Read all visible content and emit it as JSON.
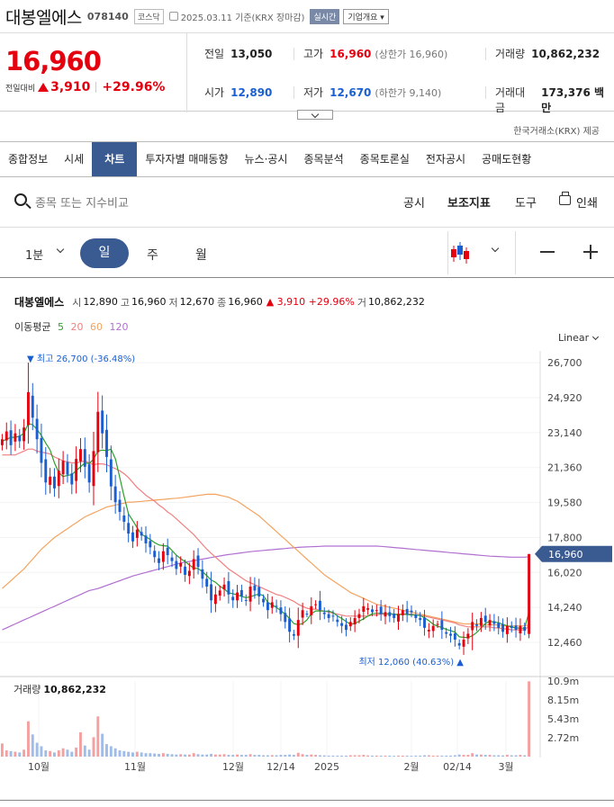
{
  "header": {
    "name": "대봉엘에스",
    "code": "078140",
    "market": "코스닥",
    "date": "2025.03.11 기준(KRX 장마감)",
    "live": "실시간",
    "corp": "기업개요 ▾"
  },
  "quote": {
    "price": "16,960",
    "change_label": "전일대비",
    "change": "3,910",
    "change_pct": "+29.96%",
    "prev_label": "전일",
    "prev": "13,050",
    "high_label": "고가",
    "high": "16,960",
    "upper_limit": "(상한가 16,960)",
    "volume_label": "거래량",
    "volume": "10,862,232",
    "open_label": "시가",
    "open": "12,890",
    "low_label": "저가",
    "low": "12,670",
    "lower_limit": "(하한가 9,140)",
    "amount_label": "거래대금",
    "amount": "173,376 백만",
    "provider": "한국거래소(KRX) 제공"
  },
  "tabs": [
    "종합정보",
    "시세",
    "차트",
    "투자자별 매매동향",
    "뉴스·공시",
    "종목분석",
    "종목토론실",
    "전자공시",
    "공매도현황"
  ],
  "active_tab": "차트",
  "toolbar": {
    "search_placeholder": "종목 또는 지수비교",
    "disclosure": "공시",
    "indicator": "보조지표",
    "tools": "도구",
    "print": "인쇄"
  },
  "period": {
    "minute": "1분",
    "day": "일",
    "week": "주",
    "month": "월"
  },
  "chart_info": {
    "name": "대봉엘에스",
    "open_label": "시",
    "open": "12,890",
    "high_label": "고",
    "high": "16,960",
    "low_label": "저",
    "low": "12,670",
    "close_label": "종",
    "close": "16,960",
    "change": "▲ 3,910 +29.96%",
    "vol_label": "거",
    "vol": "10,862,232",
    "ma_label": "이동평균",
    "ma": [
      "5",
      "20",
      "60",
      "120"
    ],
    "scale": "Linear"
  },
  "colors": {
    "up": "#e4000f",
    "down": "#1a5fd1",
    "accent": "#3a5a92",
    "ma5": "#2ca02c",
    "ma20": "#f08080",
    "ma60": "#f4a460",
    "ma120": "#b070d0"
  },
  "chart_data": {
    "type": "candlestick",
    "price_axis": [
      "26,700",
      "24,920",
      "23,140",
      "21,360",
      "19,580",
      "17,800",
      "16,020",
      "14,240",
      "12,460"
    ],
    "ylim": [
      11500,
      27300
    ],
    "current_price_label": "16,960",
    "current_price": 16960,
    "max_label": "최고 26,700 (-36.48%)",
    "max": 26700,
    "min_label": "최저 12,060 (40.63%)",
    "min": 12060,
    "x_labels": [
      "10월",
      "11월",
      "12월",
      "12/14",
      "2025",
      "2월",
      "02/14",
      "3월"
    ],
    "volume_label": "거래량",
    "volume_value": "10,862,232",
    "volume_axis": [
      "10.9m",
      "8.15m",
      "5.43m",
      "2.72m"
    ],
    "volume_ylim": [
      0,
      10900000
    ],
    "closes": [
      22800,
      23200,
      22500,
      23100,
      22700,
      23400,
      25200,
      23900,
      22800,
      21600,
      20600,
      20900,
      20300,
      21200,
      21700,
      21000,
      20500,
      21800,
      22300,
      21400,
      20600,
      22200,
      24200,
      23100,
      21900,
      20400,
      19600,
      19100,
      18600,
      18000,
      17600,
      18200,
      17900,
      17500,
      17300,
      16800,
      16500,
      17100,
      16900,
      16600,
      16200,
      16500,
      15900,
      16100,
      16700,
      16300,
      15700,
      15300,
      14600,
      14900,
      15100,
      15400,
      14900,
      14600,
      15000,
      14800,
      14600,
      15300,
      15100,
      14800,
      14500,
      14100,
      14500,
      14300,
      13900,
      13500,
      13000,
      12800,
      13600,
      14100,
      13900,
      14300,
      14400,
      14100,
      13900,
      13700,
      13800,
      13500,
      13300,
      13100,
      13500,
      13700,
      13900,
      14300,
      14200,
      14000,
      14100,
      13900,
      14000,
      13800,
      13700,
      13900,
      14100,
      13900,
      14000,
      13700,
      13600,
      13200,
      13100,
      13300,
      13400,
      13100,
      12900,
      12800,
      12600,
      12300,
      12600,
      12900,
      13500,
      13300,
      13700,
      13500,
      13600,
      13400,
      13200,
      13000,
      13300,
      13200,
      13100,
      13300,
      13050,
      16960
    ],
    "ma5": [
      22700,
      22800,
      22900,
      22900,
      22960,
      23100,
      23600,
      23540,
      23300,
      23000,
      22600,
      22260,
      21600,
      21100,
      20900,
      20960,
      21000,
      21200,
      21400,
      21600,
      21560,
      21800,
      22200,
      22250,
      22220,
      22300,
      21800,
      20850,
      19900,
      19000,
      18660,
      18300,
      17960,
      17840,
      17700,
      17540,
      17420,
      17380,
      17360,
      17140,
      16900,
      16720,
      16580,
      16400,
      16240,
      16220,
      16060,
      15860,
      15640,
      15520,
      15320,
      15180,
      14980,
      14940,
      14880,
      14800,
      14740,
      14780,
      14860,
      14920,
      14840,
      14500,
      14370,
      14240,
      14080,
      13900,
      13680,
      13420,
      13360,
      13420,
      13600,
      13920,
      14060,
      14060,
      14050,
      14050,
      13980,
      13800,
      13680,
      13520,
      13380,
      13420,
      13540,
      13660,
      13800,
      13920,
      13940,
      13940,
      13920,
      13920,
      13900,
      13860,
      13900,
      13880,
      13860,
      13860,
      13820,
      13720,
      13560,
      13380,
      13280,
      13220,
      13120,
      13060,
      12980,
      12740,
      12720,
      12700,
      12800,
      12960,
      13200,
      13420,
      13540,
      13500,
      13460,
      13380,
      13300,
      13240,
      13200,
      13180,
      13190,
      14000
    ],
    "ma20": [
      22000,
      22000,
      22000,
      22000,
      22100,
      22200,
      22300,
      22300,
      22200,
      22150,
      22100,
      22050,
      21900,
      21800,
      21700,
      21650,
      21600,
      21600,
      21650,
      21700,
      21600,
      21500,
      21550,
      21550,
      21500,
      21400,
      21300,
      21200,
      21050,
      20850,
      20600,
      20350,
      20150,
      19950,
      19800,
      19650,
      19450,
      19300,
      19100,
      18950,
      18750,
      18550,
      18350,
      18150,
      17950,
      17700,
      17450,
      17200,
      17000,
      16800,
      16600,
      16400,
      16200,
      16050,
      15900,
      15750,
      15600,
      15500,
      15400,
      15300,
      15200,
      15100,
      15000,
      14900,
      14850,
      14750,
      14650,
      14550,
      14400,
      14300,
      14200,
      14150,
      14150,
      14100,
      14050,
      14000,
      13950,
      13900,
      13850,
      13800,
      13800,
      13800,
      13800,
      13800,
      13800,
      13850,
      13850,
      13900,
      13900,
      13900,
      13900,
      13900,
      13900,
      13900,
      13900,
      13850,
      13850,
      13800,
      13750,
      13700,
      13650,
      13600,
      13550,
      13500,
      13450,
      13350,
      13300,
      13250,
      13250,
      13250,
      13250,
      13250,
      13250,
      13200,
      13200,
      13150,
      13150,
      13100,
      13100,
      13100,
      13100,
      13300
    ],
    "ma60": [
      15200,
      15400,
      15600,
      15800,
      16000,
      16200,
      16450,
      16700,
      16950,
      17200,
      17400,
      17600,
      17800,
      17950,
      18100,
      18250,
      18400,
      18550,
      18700,
      18850,
      18950,
      19050,
      19150,
      19250,
      19350,
      19400,
      19450,
      19500,
      19550,
      19600,
      19600,
      19620,
      19640,
      19660,
      19680,
      19700,
      19720,
      19740,
      19760,
      19780,
      19800,
      19820,
      19850,
      19880,
      19910,
      19940,
      19970,
      20000,
      20000,
      20000,
      19950,
      19900,
      19850,
      19750,
      19650,
      19500,
      19350,
      19200,
      19050,
      18900,
      18700,
      18500,
      18300,
      18100,
      17900,
      17700,
      17500,
      17300,
      17100,
      16900,
      16700,
      16500,
      16300,
      16100,
      15900,
      15750,
      15600,
      15450,
      15300,
      15150,
      15000,
      14900,
      14800,
      14700,
      14600,
      14500,
      14400,
      14350,
      14300,
      14250,
      14200,
      14150,
      14100,
      14050,
      14000,
      13950,
      13900,
      13850,
      13800,
      13750,
      13700,
      13650,
      13600,
      13550,
      13500,
      13450,
      13400,
      13400,
      13400,
      13400,
      13400,
      13350,
      13350,
      13350,
      13350,
      13300,
      13300,
      13300,
      13300,
      13300,
      13300,
      13350
    ],
    "ma120": [
      13100,
      13200,
      13300,
      13400,
      13500,
      13600,
      13700,
      13800,
      13900,
      14000,
      14100,
      14200,
      14300,
      14400,
      14500,
      14600,
      14700,
      14800,
      14900,
      15000,
      15100,
      15150,
      15200,
      15280,
      15360,
      15440,
      15520,
      15600,
      15680,
      15760,
      15840,
      15900,
      15960,
      16020,
      16080,
      16140,
      16200,
      16260,
      16320,
      16380,
      16440,
      16500,
      16540,
      16580,
      16620,
      16660,
      16700,
      16740,
      16780,
      16820,
      16860,
      16900,
      16930,
      16960,
      16990,
      17020,
      17050,
      17080,
      17100,
      17120,
      17140,
      17160,
      17180,
      17200,
      17220,
      17240,
      17260,
      17280,
      17300,
      17310,
      17320,
      17330,
      17340,
      17350,
      17360,
      17360,
      17360,
      17360,
      17360,
      17360,
      17360,
      17360,
      17360,
      17360,
      17360,
      17360,
      17360,
      17350,
      17330,
      17310,
      17290,
      17270,
      17250,
      17230,
      17210,
      17190,
      17170,
      17150,
      17130,
      17110,
      17090,
      17070,
      17050,
      17030,
      17010,
      16990,
      16970,
      16950,
      16930,
      16910,
      16890,
      16870,
      16850,
      16840,
      16830,
      16820,
      16810,
      16800,
      16800,
      16800,
      16800,
      16820
    ],
    "volumes": [
      1900000,
      900000,
      800000,
      700000,
      600000,
      1000000,
      5100000,
      3200000,
      2000000,
      1500000,
      900000,
      800000,
      600000,
      900000,
      1200000,
      1000000,
      700000,
      1300000,
      3500000,
      1600000,
      1000000,
      2800000,
      5800000,
      3300000,
      1800000,
      1500000,
      1200000,
      900000,
      800000,
      700000,
      600000,
      700000,
      600000,
      500000,
      500000,
      450000,
      400000,
      500000,
      400000,
      350000,
      300000,
      350000,
      300000,
      300000,
      500000,
      350000,
      300000,
      300000,
      400000,
      300000,
      300000,
      350000,
      250000,
      250000,
      300000,
      250000,
      250000,
      350000,
      250000,
      250000,
      200000,
      200000,
      220000,
      200000,
      250000,
      250000,
      300000,
      250000,
      550000,
      350000,
      250000,
      300000,
      250000,
      200000,
      180000,
      150000,
      150000,
      150000,
      150000,
      150000,
      200000,
      200000,
      200000,
      250000,
      180000,
      150000,
      150000,
      150000,
      150000,
      150000,
      120000,
      150000,
      150000,
      150000,
      120000,
      150000,
      150000,
      200000,
      200000,
      150000,
      150000,
      150000,
      150000,
      150000,
      200000,
      300000,
      250000,
      250000,
      500000,
      300000,
      300000,
      250000,
      250000,
      200000,
      200000,
      180000,
      250000,
      200000,
      200000,
      250000,
      200000,
      10862232
    ]
  }
}
